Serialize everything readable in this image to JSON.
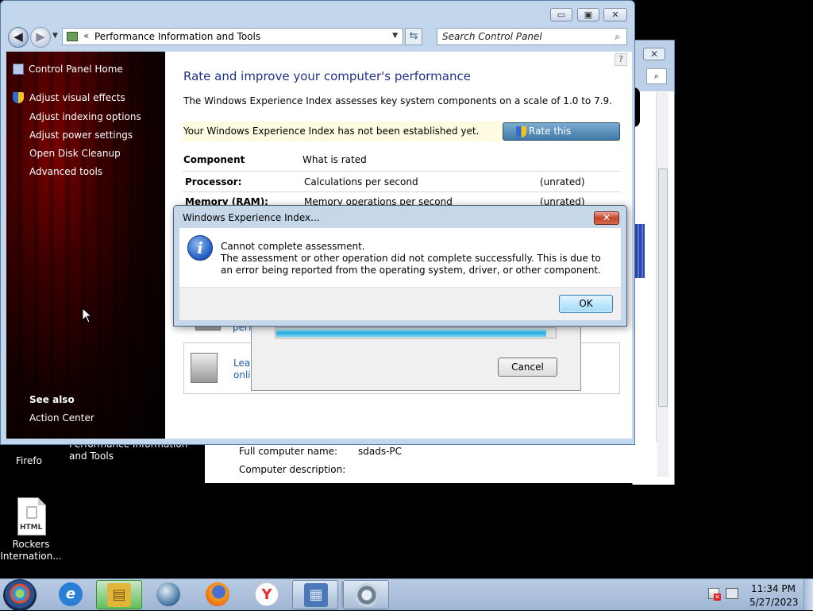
{
  "desktop": {
    "icons": [
      {
        "label": "Firefo"
      },
      {
        "label": "Rockers\nInternation..."
      }
    ],
    "html_badge": "HTML"
  },
  "back_window": {
    "close_glyph": "✕",
    "left_text": "Performance Information and Tools",
    "full_computer_name_label": "Full computer name:",
    "full_computer_name_value": "sdads-PC",
    "computer_description_label": "Computer description:"
  },
  "window": {
    "caption_buttons": {
      "minimize": "▭",
      "maximize": "▣",
      "close": "✕"
    },
    "address": {
      "chevron": "«",
      "path": "Performance Information and Tools"
    },
    "search": {
      "placeholder": "Search Control Panel"
    },
    "sidebar": {
      "home": "Control Panel Home",
      "items": [
        {
          "label": "Adjust visual effects"
        },
        {
          "label": "Adjust indexing options"
        },
        {
          "label": "Adjust power settings"
        },
        {
          "label": "Open Disk Cleanup"
        },
        {
          "label": "Advanced tools"
        }
      ],
      "see_also": "See also",
      "see_also_items": [
        {
          "label": "Action Center"
        }
      ]
    },
    "content": {
      "heading": "Rate and improve your computer's performance",
      "description": "The Windows Experience Index assesses key system components on a scale of 1.0 to 7.9.",
      "status_message": "Your Windows Experience Index has not been established yet.",
      "rate_button": "Rate this computer",
      "table": {
        "headers": [
          "Component",
          "What is rated"
        ],
        "rows": [
          {
            "component": "Processor:",
            "rated": "Calculations per second",
            "score": "(unrated)"
          },
          {
            "component": "Memory (RAM):",
            "rated": "Memory operations per second",
            "score": "(unrated)"
          }
        ]
      },
      "tips": [
        {
          "text": "perf"
        },
        {
          "text_line1": "Lear",
          "text_line2": "onli"
        }
      ]
    }
  },
  "progress_dialog": {
    "progress": 0.97,
    "cancel_label": "Cancel"
  },
  "error_dialog": {
    "title": "Windows Experience Index...",
    "close_glyph": "✕",
    "icon_glyph": "i",
    "heading": "Cannot complete assessment.",
    "message": "The assessment or other operation did not complete successfully. This is due to an error being reported from the operating system, driver, or other component.",
    "ok_label": "OK"
  },
  "taskbar": {
    "items": [
      {
        "name": "internet-explorer",
        "glyph": "e",
        "color": "#2a7fd4"
      },
      {
        "name": "windows-explorer",
        "glyph": "▤",
        "color": "#e0b53a"
      },
      {
        "name": "network-globe",
        "glyph": "●",
        "color": "#3d6f9e"
      },
      {
        "name": "firefox",
        "glyph": "◉",
        "color": "#e56a1c"
      },
      {
        "name": "yandex",
        "glyph": "Y",
        "color": "#e32d2d"
      },
      {
        "name": "performance-tools",
        "glyph": "▦",
        "color": "#4a78b8"
      },
      {
        "name": "busy-process",
        "glyph": "◌",
        "color": "#6d7f92"
      }
    ],
    "clock_time": "11:34 PM",
    "clock_date": "5/27/2023"
  }
}
